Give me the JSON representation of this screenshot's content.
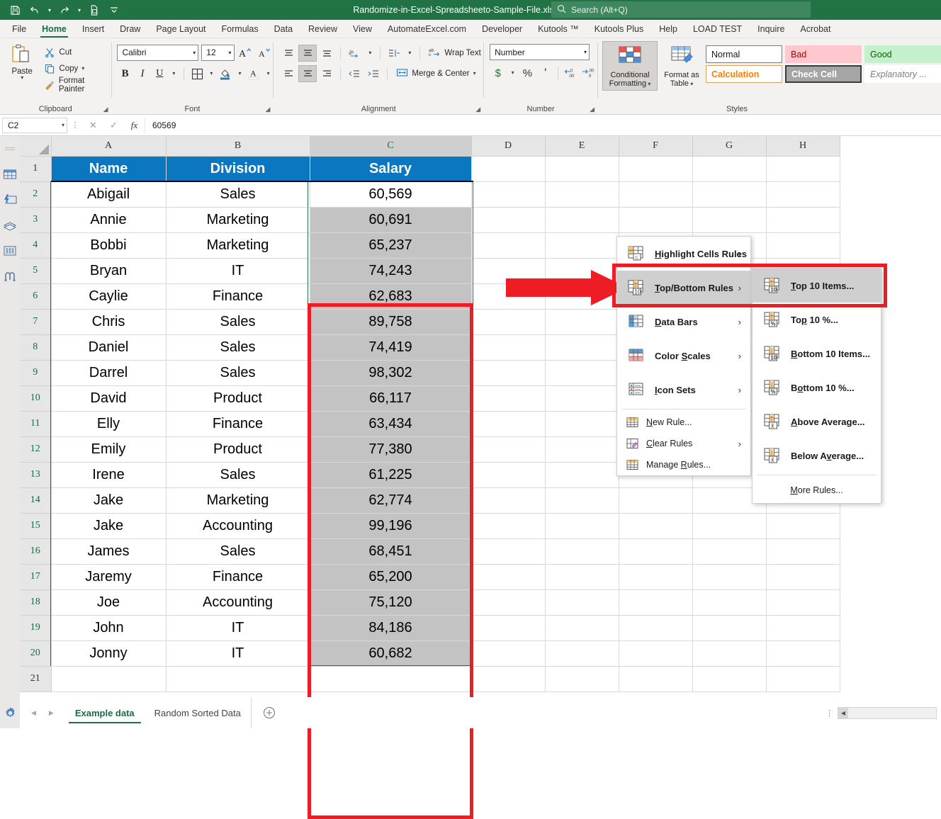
{
  "titlebar": {
    "file_title": "Randomize-in-Excel-Spreadsheeto-Sample-File.xlsx  -  Excel",
    "qat": [
      {
        "name": "save-icon",
        "label": "Save"
      },
      {
        "name": "undo-icon",
        "label": "Undo"
      },
      {
        "name": "redo-icon",
        "label": "Redo"
      },
      {
        "name": "quick-print-icon",
        "label": "Quick Print"
      },
      {
        "name": "customize-qat-icon",
        "label": "Customize Quick Access Toolbar"
      }
    ],
    "search_placeholder": "Search (Alt+Q)",
    "search_icon": "search-icon"
  },
  "ribbon_tabs": [
    {
      "label": "File",
      "active": false
    },
    {
      "label": "Home",
      "active": true
    },
    {
      "label": "Insert",
      "active": false
    },
    {
      "label": "Draw",
      "active": false
    },
    {
      "label": "Page Layout",
      "active": false
    },
    {
      "label": "Formulas",
      "active": false
    },
    {
      "label": "Data",
      "active": false
    },
    {
      "label": "Review",
      "active": false
    },
    {
      "label": "View",
      "active": false
    },
    {
      "label": "AutomateExcel.com",
      "active": false
    },
    {
      "label": "Developer",
      "active": false
    },
    {
      "label": "Kutools ™",
      "active": false
    },
    {
      "label": "Kutools Plus",
      "active": false
    },
    {
      "label": "Help",
      "active": false
    },
    {
      "label": "LOAD TEST",
      "active": false
    },
    {
      "label": "Inquire",
      "active": false
    },
    {
      "label": "Acrobat",
      "active": false
    }
  ],
  "ribbon": {
    "clipboard": {
      "group_label": "Clipboard",
      "paste_label": "Paste",
      "items": [
        {
          "label": "Cut",
          "icon": "scissors-icon"
        },
        {
          "label": "Copy",
          "icon": "copy-icon"
        },
        {
          "label": "Format Painter",
          "icon": "format-painter-icon"
        }
      ]
    },
    "font": {
      "group_label": "Font",
      "font_name": "Calibri",
      "font_size": "12",
      "buttons": [
        "grow-font-icon",
        "shrink-font-icon",
        "bold-icon",
        "italic-icon",
        "underline-icon",
        "borders-icon",
        "fill-color-icon",
        "font-color-icon"
      ]
    },
    "alignment": {
      "group_label": "Alignment",
      "wrap_text_label": "Wrap Text",
      "merge_center_label": "Merge & Center"
    },
    "number": {
      "group_label": "Number",
      "format_value": "Number",
      "buttons": [
        "currency-icon",
        "percent-icon",
        "comma-icon",
        "decrease-decimal-icon",
        "increase-decimal-icon"
      ]
    },
    "styles": {
      "group_label": "Styles",
      "conditional_formatting_label": "Conditional\nFormatting",
      "conditional_formatting_line1": "Conditional",
      "conditional_formatting_line2": "Formatting",
      "format_as_table_line1": "Format as",
      "format_as_table_line2": "Table",
      "gallery": [
        {
          "label": "Normal",
          "bg": "#ffffff",
          "fg": "#1a1a1a"
        },
        {
          "label": "Bad",
          "bg": "#ffc7ce",
          "fg": "#9c0006"
        },
        {
          "label": "Good",
          "bg": "#c6efce",
          "fg": "#006100"
        },
        {
          "label": "Calculation",
          "bg": "#ffffff",
          "fg": "#fa7d00"
        },
        {
          "label": "Check Cell",
          "bg": "#a5a5a5",
          "fg": "#ffffff"
        },
        {
          "label": "Explanatory ...",
          "bg": "#ffffff",
          "fg": "#7f7f7f"
        }
      ]
    }
  },
  "formula_bar": {
    "name_box": "C2",
    "cancel_icon": "cancel-icon",
    "enter_icon": "confirm-icon",
    "function_icon": "insert-function-icon",
    "value": "60569"
  },
  "cf_menu": {
    "items": [
      {
        "label_pre": "",
        "label_key": "H",
        "label_post": "ighlight Cells Rules",
        "icon": "highlight-cells-rules-icon",
        "has_arrow": true,
        "selected": false
      },
      {
        "label_pre": "",
        "label_key": "T",
        "label_post": "op/Bottom Rules",
        "icon": "top-bottom-rules-icon",
        "has_arrow": true,
        "selected": true
      },
      {
        "label_pre": "",
        "label_key": "D",
        "label_post": "ata Bars",
        "icon": "data-bars-icon",
        "has_arrow": true,
        "selected": false
      },
      {
        "label_pre": "Color ",
        "label_key": "S",
        "label_post": "cales",
        "icon": "color-scales-icon",
        "has_arrow": true,
        "selected": false
      },
      {
        "label_pre": "",
        "label_key": "I",
        "label_post": "con Sets",
        "icon": "icon-sets-icon",
        "has_arrow": true,
        "selected": false
      }
    ],
    "footer_items": [
      {
        "label_pre": "",
        "label_key": "N",
        "label_post": "ew Rule...",
        "icon": "new-rule-icon",
        "has_arrow": false
      },
      {
        "label_pre": "",
        "label_key": "C",
        "label_post": "lear Rules",
        "icon": "clear-rules-icon",
        "has_arrow": true
      },
      {
        "label_pre": "Manage ",
        "label_key": "R",
        "label_post": "ules...",
        "icon": "manage-rules-icon",
        "has_arrow": false
      }
    ]
  },
  "topbottom_submenu": {
    "items": [
      {
        "label_pre": "",
        "label_key": "T",
        "label_post": "op 10 Items...",
        "icon": "top-10-items-icon",
        "selected": true
      },
      {
        "label_pre": "To",
        "label_key": "p",
        "label_post": " 10 %...",
        "icon": "top-10-percent-icon",
        "selected": false
      },
      {
        "label_pre": "",
        "label_key": "B",
        "label_post": "ottom 10 Items...",
        "icon": "bottom-10-items-icon",
        "selected": false
      },
      {
        "label_pre": "B",
        "label_key": "o",
        "label_post": "ttom 10 %...",
        "icon": "bottom-10-percent-icon",
        "selected": false
      },
      {
        "label_pre": "",
        "label_key": "A",
        "label_post": "bove Average...",
        "icon": "above-average-icon",
        "selected": false
      },
      {
        "label_pre": "Below A",
        "label_key": "v",
        "label_post": "erage...",
        "icon": "below-average-icon",
        "selected": false
      }
    ],
    "more_rules_pre": "",
    "more_rules_key": "M",
    "more_rules_post": "ore Rules..."
  },
  "sheet": {
    "column_headers": [
      "A",
      "B",
      "C",
      "D",
      "E",
      "F",
      "G",
      "H"
    ],
    "selected_column": "C",
    "header_row": [
      "Name",
      "Division",
      "Salary"
    ],
    "rows": [
      {
        "n": "2",
        "name": "Abigail",
        "division": "Sales",
        "salary": "60,569",
        "active": true
      },
      {
        "n": "3",
        "name": "Annie",
        "division": "Marketing",
        "salary": "60,691",
        "active": false
      },
      {
        "n": "4",
        "name": "Bobbi",
        "division": "Marketing",
        "salary": "65,237",
        "active": false
      },
      {
        "n": "5",
        "name": "Bryan",
        "division": "IT",
        "salary": "74,243",
        "active": false
      },
      {
        "n": "6",
        "name": "Caylie",
        "division": "Finance",
        "salary": "62,683",
        "active": false
      },
      {
        "n": "7",
        "name": "Chris",
        "division": "Sales",
        "salary": "89,758",
        "active": false
      },
      {
        "n": "8",
        "name": "Daniel",
        "division": "Sales",
        "salary": "74,419",
        "active": false
      },
      {
        "n": "9",
        "name": "Darrel",
        "division": "Sales",
        "salary": "98,302",
        "active": false
      },
      {
        "n": "10",
        "name": "David",
        "division": "Product",
        "salary": "66,117",
        "active": false
      },
      {
        "n": "11",
        "name": "Elly",
        "division": "Finance",
        "salary": "63,434",
        "active": false
      },
      {
        "n": "12",
        "name": "Emily",
        "division": "Product",
        "salary": "77,380",
        "active": false
      },
      {
        "n": "13",
        "name": "Irene",
        "division": "Sales",
        "salary": "61,225",
        "active": false
      },
      {
        "n": "14",
        "name": "Jake",
        "division": "Marketing",
        "salary": "62,774",
        "active": false
      },
      {
        "n": "15",
        "name": "Jake",
        "division": "Accounting",
        "salary": "99,196",
        "active": false
      },
      {
        "n": "16",
        "name": "James",
        "division": "Sales",
        "salary": "68,451",
        "active": false
      },
      {
        "n": "17",
        "name": "Jaremy",
        "division": "Finance",
        "salary": "65,200",
        "active": false
      },
      {
        "n": "18",
        "name": "Joe",
        "division": "Accounting",
        "salary": "75,120",
        "active": false
      },
      {
        "n": "19",
        "name": "John",
        "division": "IT",
        "salary": "84,186",
        "active": false
      },
      {
        "n": "20",
        "name": "Jonny",
        "division": "IT",
        "salary": "60,682",
        "active": false
      }
    ],
    "header_row_number": "1",
    "last_row_number": "21"
  },
  "sheet_tabs": {
    "tabs": [
      {
        "label": "Example data",
        "active": true
      },
      {
        "label": "Random Sorted Data",
        "active": false
      }
    ],
    "add_sheet_icon": "add-sheet-icon",
    "prev_icon": "prev-sheet-icon",
    "next_icon": "next-sheet-icon"
  },
  "left_rail_icons": [
    "panel-collapse-icon",
    "table-icon",
    "flash-fill-icon",
    "stack-icon",
    "columns-icon",
    "find-icon"
  ],
  "annotations": {
    "arrow_color": "#ee1c25",
    "box_color": "#ee1c25"
  }
}
